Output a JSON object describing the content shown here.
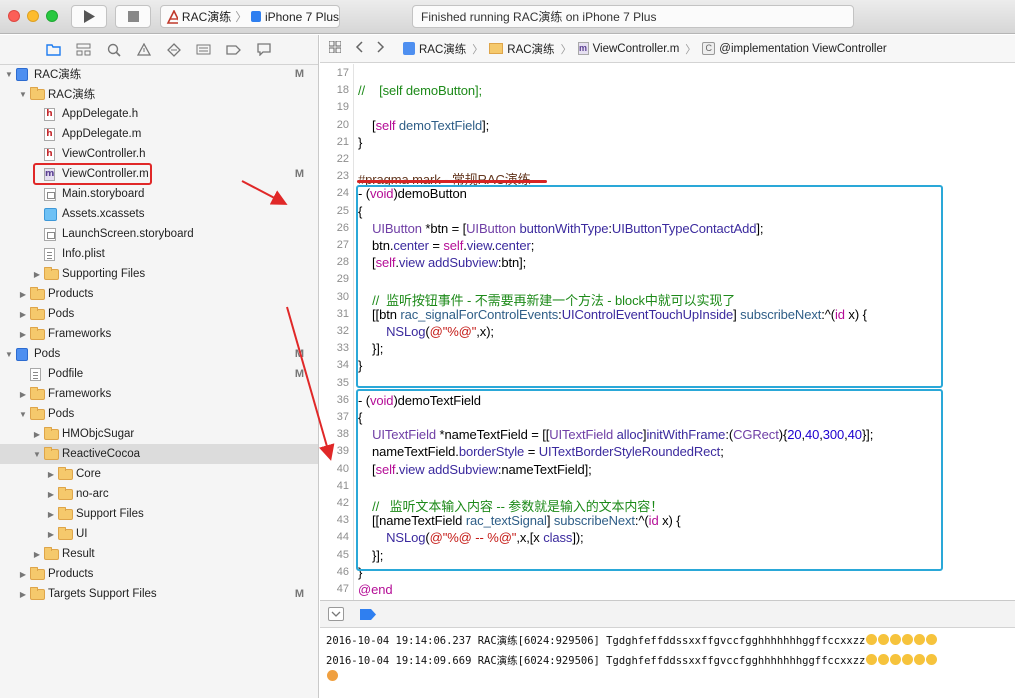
{
  "titlebar": {
    "scheme_project": "RAC演练",
    "scheme_device": "iPhone 7 Plus",
    "status_text": "Finished running RAC演练 on iPhone 7 Plus",
    "scheme_separator": "〉"
  },
  "navigator": {
    "toolbar_icons": [
      "folder-icon",
      "hierarchy-icon",
      "search-icon",
      "warning-icon",
      "test-icon",
      "debug-icon",
      "breakpoint-icon",
      "report-icon"
    ],
    "items": [
      {
        "label": "RAC演练",
        "badge": "M",
        "kind": "project",
        "depth": 0,
        "expanded": true
      },
      {
        "label": "RAC演练",
        "badge": "",
        "kind": "folder",
        "depth": 1,
        "expanded": true
      },
      {
        "label": "AppDelegate.h",
        "badge": "",
        "kind": "h",
        "depth": 2
      },
      {
        "label": "AppDelegate.m",
        "badge": "",
        "kind": "h",
        "depth": 2
      },
      {
        "label": "ViewController.h",
        "badge": "",
        "kind": "h",
        "depth": 2
      },
      {
        "label": "ViewController.m",
        "badge": "M",
        "kind": "m",
        "depth": 2,
        "selected": true
      },
      {
        "label": "Main.storyboard",
        "badge": "",
        "kind": "storyboard",
        "depth": 2
      },
      {
        "label": "Assets.xcassets",
        "badge": "",
        "kind": "asset",
        "depth": 2
      },
      {
        "label": "LaunchScreen.storyboard",
        "badge": "",
        "kind": "storyboard",
        "depth": 2
      },
      {
        "label": "Info.plist",
        "badge": "",
        "kind": "plist",
        "depth": 2
      },
      {
        "label": "Supporting Files",
        "badge": "",
        "kind": "folder",
        "depth": 2,
        "expanded": false
      },
      {
        "label": "Products",
        "badge": "",
        "kind": "folder",
        "depth": 1,
        "expanded": false
      },
      {
        "label": "Pods",
        "badge": "",
        "kind": "folder",
        "depth": 1,
        "expanded": false
      },
      {
        "label": "Frameworks",
        "badge": "",
        "kind": "folder",
        "depth": 1,
        "expanded": false
      },
      {
        "label": "Pods",
        "badge": "M",
        "kind": "project",
        "depth": 0,
        "expanded": true
      },
      {
        "label": "Podfile",
        "badge": "M",
        "kind": "plist",
        "depth": 1
      },
      {
        "label": "Frameworks",
        "badge": "",
        "kind": "folder",
        "depth": 1,
        "expanded": false
      },
      {
        "label": "Pods",
        "badge": "",
        "kind": "folder",
        "depth": 1,
        "expanded": true
      },
      {
        "label": "HMObjcSugar",
        "badge": "",
        "kind": "folder",
        "depth": 2,
        "expanded": false
      },
      {
        "label": "ReactiveCocoa",
        "badge": "",
        "kind": "folder",
        "depth": 2,
        "expanded": true,
        "highlight": true
      },
      {
        "label": "Core",
        "badge": "",
        "kind": "folder",
        "depth": 3,
        "expanded": false
      },
      {
        "label": "no-arc",
        "badge": "",
        "kind": "folder",
        "depth": 3,
        "expanded": false
      },
      {
        "label": "Support Files",
        "badge": "",
        "kind": "folder",
        "depth": 3,
        "expanded": false
      },
      {
        "label": "UI",
        "badge": "",
        "kind": "folder",
        "depth": 3,
        "expanded": false
      },
      {
        "label": "Result",
        "badge": "",
        "kind": "folder",
        "depth": 2,
        "expanded": false
      },
      {
        "label": "Products",
        "badge": "",
        "kind": "folder",
        "depth": 1,
        "expanded": false
      },
      {
        "label": "Targets Support Files",
        "badge": "M",
        "kind": "folder",
        "depth": 1,
        "expanded": false
      }
    ]
  },
  "jumpbar": {
    "crumbs": [
      "RAC演练",
      "RAC演练",
      "ViewController.m",
      "@implementation ViewController"
    ]
  },
  "editor": {
    "lines": [
      {
        "n": "17",
        "html": ""
      },
      {
        "n": "18",
        "html": "<span class='cmt'>//    [self demoButton];</span>"
      },
      {
        "n": "19",
        "html": ""
      },
      {
        "n": "20",
        "html": "    [<span class='kw'>self</span> <span class='mth2'>demoTextField</span>];"
      },
      {
        "n": "21",
        "html": "}"
      },
      {
        "n": "22",
        "html": ""
      },
      {
        "n": "23",
        "html": "<span class='prag'>#pragma mark - 常规RAC演练</span>"
      },
      {
        "n": "24",
        "html": "- (<span class='kw'>void</span>)demoButton"
      },
      {
        "n": "25",
        "html": "{"
      },
      {
        "n": "26",
        "html": "    <span class='cls'>UIButton</span> *btn = [<span class='cls'>UIButton</span> <span class='mth'>buttonWithType</span>:<span class='mth'>UIButtonTypeContactAdd</span>];"
      },
      {
        "n": "27",
        "html": "    btn.<span class='mth'>center</span> = <span class='kw'>self</span>.<span class='mth'>view</span>.<span class='mth'>center</span>;"
      },
      {
        "n": "28",
        "html": "    [<span class='kw'>self</span>.<span class='mth'>view</span> <span class='mth'>addSubview</span>:btn];"
      },
      {
        "n": "29",
        "html": ""
      },
      {
        "n": "30",
        "html": "    <span class='cmt'>//  监听按钮事件 - 不需要再新建一个方法 - block中就可以实现了</span>"
      },
      {
        "n": "31",
        "html": "    [[btn <span class='mth2'>rac_signalForControlEvents</span>:<span class='mth'>UIControlEventTouchUpInside</span>] <span class='mth2'>subscribeNext</span>:^(<span class='kw'>id</span> x) {"
      },
      {
        "n": "32",
        "html": "        <span class='mth'>NSLog</span>(<span class='str'>@\"%@\"</span>,x);"
      },
      {
        "n": "33",
        "html": "    }];"
      },
      {
        "n": "34",
        "html": "}"
      },
      {
        "n": "35",
        "html": ""
      },
      {
        "n": "36",
        "html": "- (<span class='kw'>void</span>)demoTextField"
      },
      {
        "n": "37",
        "html": "{"
      },
      {
        "n": "38",
        "html": "    <span class='cls'>UITextField</span> *nameTextField = [[<span class='cls'>UITextField</span> <span class='mth'>alloc</span>]<span class='mth'>initWithFrame</span>:(<span class='cls'>CGRect</span>){<span class='num'>20</span>,<span class='num'>40</span>,<span class='num'>300</span>,<span class='num'>40</span>}];"
      },
      {
        "n": "39",
        "html": "    nameTextField.<span class='mth'>borderStyle</span> = <span class='mth'>UITextBorderStyleRoundedRect</span>;"
      },
      {
        "n": "40",
        "html": "    [<span class='kw'>self</span>.<span class='mth'>view</span> <span class='mth'>addSubview</span>:nameTextField];"
      },
      {
        "n": "41",
        "html": ""
      },
      {
        "n": "42",
        "html": "    <span class='cmt'>//   监听文本输入内容 -- 参数就是输入的文本内容！</span>"
      },
      {
        "n": "43",
        "html": "    [[nameTextField <span class='mth2'>rac_textSignal</span>] <span class='mth2'>subscribeNext</span>:^(<span class='kw'>id</span> x) {"
      },
      {
        "n": "44",
        "html": "        <span class='mth'>NSLog</span>(<span class='str'>@\"%@ -- %@\"</span>,x,[x <span class='mth'>class</span>]);"
      },
      {
        "n": "45",
        "html": "    }];"
      },
      {
        "n": "46",
        "html": "}"
      },
      {
        "n": "47",
        "html": "<span class='kw'>@end</span>"
      }
    ]
  },
  "console": {
    "lines": [
      "2016-10-04 19:14:06.237 RAC演练[6024:929506] Tgdghfeffddssxxffgvccfgghhhhhhhggffccxxzz",
      "2016-10-04 19:14:09.669 RAC演练[6024:929506] Tgdghfeffddssxxffgvccfgghhhhhhhggffccxxzz"
    ]
  },
  "colors": {
    "annotation_red": "#e02828",
    "annotation_blue": "#2aa8d8",
    "keyword": "#b40d96",
    "comment": "#1d8a19",
    "string": "#c41a16"
  }
}
